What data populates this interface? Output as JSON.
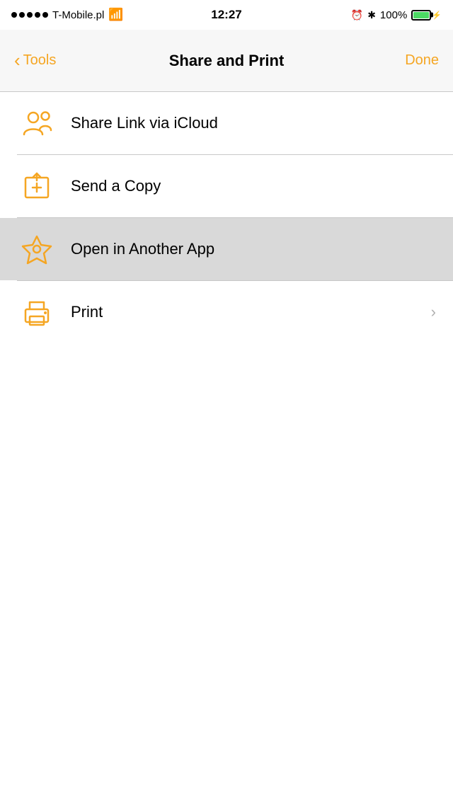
{
  "status_bar": {
    "carrier": "T-Mobile.pl",
    "time": "12:27",
    "battery_pct": "100%"
  },
  "nav": {
    "back_label": "Tools",
    "title": "Share and Print",
    "done_label": "Done"
  },
  "menu": {
    "items": [
      {
        "id": "share-link",
        "label": "Share Link via iCloud",
        "has_chevron": false,
        "highlighted": false,
        "icon": "share-link-icon"
      },
      {
        "id": "send-copy",
        "label": "Send a Copy",
        "has_chevron": false,
        "highlighted": false,
        "icon": "send-copy-icon"
      },
      {
        "id": "open-in-app",
        "label": "Open in Another App",
        "has_chevron": false,
        "highlighted": true,
        "icon": "open-in-app-icon"
      },
      {
        "id": "print",
        "label": "Print",
        "has_chevron": true,
        "highlighted": false,
        "icon": "print-icon"
      }
    ]
  }
}
